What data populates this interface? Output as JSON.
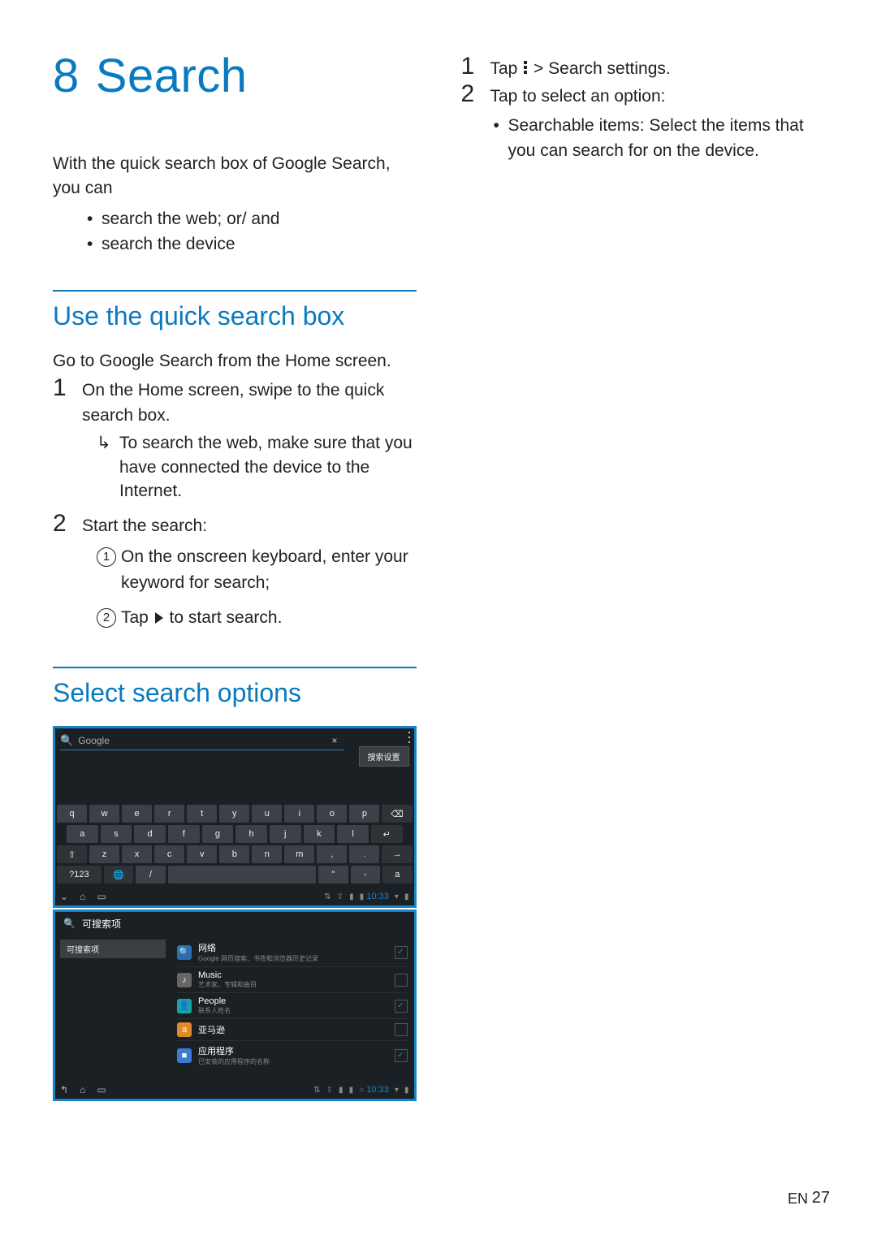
{
  "chapter": {
    "num": "8",
    "title": "Search"
  },
  "intro": "With the quick search box of Google Search, you can",
  "intro_bullets": [
    "search the web; or/ and",
    "search the device"
  ],
  "section1": {
    "title": "Use the quick search box",
    "lead": "Go to Google Search from the Home screen.",
    "steps": [
      {
        "text": "On the Home screen, swipe to the quick search box.",
        "sub": "To search the web, make sure that you have connected the device to the Internet."
      },
      {
        "text": "Start the search:",
        "circledA": "On the onscreen keyboard, enter your keyword for search;",
        "circledB_pre": "Tap ",
        "circledB_post": " to start search."
      }
    ]
  },
  "section2": {
    "title": "Select search options"
  },
  "right_steps": [
    {
      "pre": "Tap ",
      "mid": " > ",
      "bold": "Search settings",
      "post": "."
    },
    {
      "text": "Tap to select an option:",
      "bullet_bold": "Searchable items",
      "bullet_rest": ": Select the items that you can search for on the device."
    }
  ],
  "shot1": {
    "search_placeholder": "Google",
    "menu_label": "搜索设置",
    "keyboard": {
      "r1": [
        "q",
        "w",
        "e",
        "r",
        "t",
        "y",
        "u",
        "i",
        "o",
        "p",
        "⌫"
      ],
      "r2": [
        "a",
        "s",
        "d",
        "f",
        "g",
        "h",
        "j",
        "k",
        "l",
        "↵"
      ],
      "r3": [
        "⇧",
        "z",
        "x",
        "c",
        "v",
        "b",
        "n",
        "m",
        ",",
        ".",
        "→"
      ],
      "r4": [
        "?123",
        "🌐",
        "/",
        " ",
        "\"",
        "-",
        "a"
      ]
    },
    "time": "10:33"
  },
  "shot2": {
    "header": "可搜索项",
    "side_item": "可搜索项",
    "rows": [
      {
        "title": "网络",
        "sub": "Google 网页搜索、书签和浏览器历史记录",
        "on": true,
        "color": "#2a6fb5",
        "glyph": "🔍"
      },
      {
        "title": "Music",
        "sub": "艺术家、专辑和曲目",
        "on": false,
        "color": "#666",
        "glyph": "♪"
      },
      {
        "title": "People",
        "sub": "联系人姓名",
        "on": true,
        "color": "#1aa3a3",
        "glyph": "👤"
      },
      {
        "title": "亚马逊",
        "sub": "",
        "on": false,
        "color": "#e08a2c",
        "glyph": "a"
      },
      {
        "title": "应用程序",
        "sub": "已安装的应用程序的名称",
        "on": true,
        "color": "#3a7bd5",
        "glyph": "■"
      }
    ],
    "time": "10:33"
  },
  "footer": {
    "lang": "EN",
    "page": "27"
  }
}
